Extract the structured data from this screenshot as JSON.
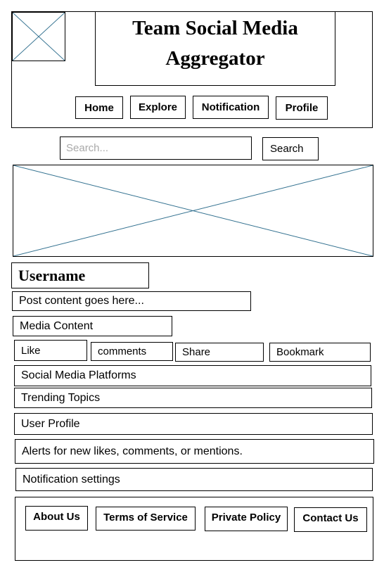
{
  "header": {
    "title_line1": "Team Social Media",
    "title_line2": "Aggregator",
    "nav": [
      "Home",
      "Explore",
      "Notification",
      "Profile"
    ]
  },
  "search": {
    "placeholder": "Search...",
    "button": "Search"
  },
  "post": {
    "username": "Username",
    "content": "Post content goes here...",
    "media": "Media Content",
    "actions": [
      "Like",
      "comments",
      "Share",
      "Bookmark"
    ]
  },
  "sections": {
    "platforms": "Social Media Platforms",
    "trending": "Trending Topics",
    "user_profile": "User Profile",
    "alerts": "Alerts for new likes, comments, or mentions.",
    "notification_settings": "Notification settings"
  },
  "footer": {
    "links": [
      "About Us",
      "Terms of Service",
      "Private Policy",
      "Contact Us"
    ]
  },
  "colors": {
    "placeholder_line": "#31708f"
  }
}
